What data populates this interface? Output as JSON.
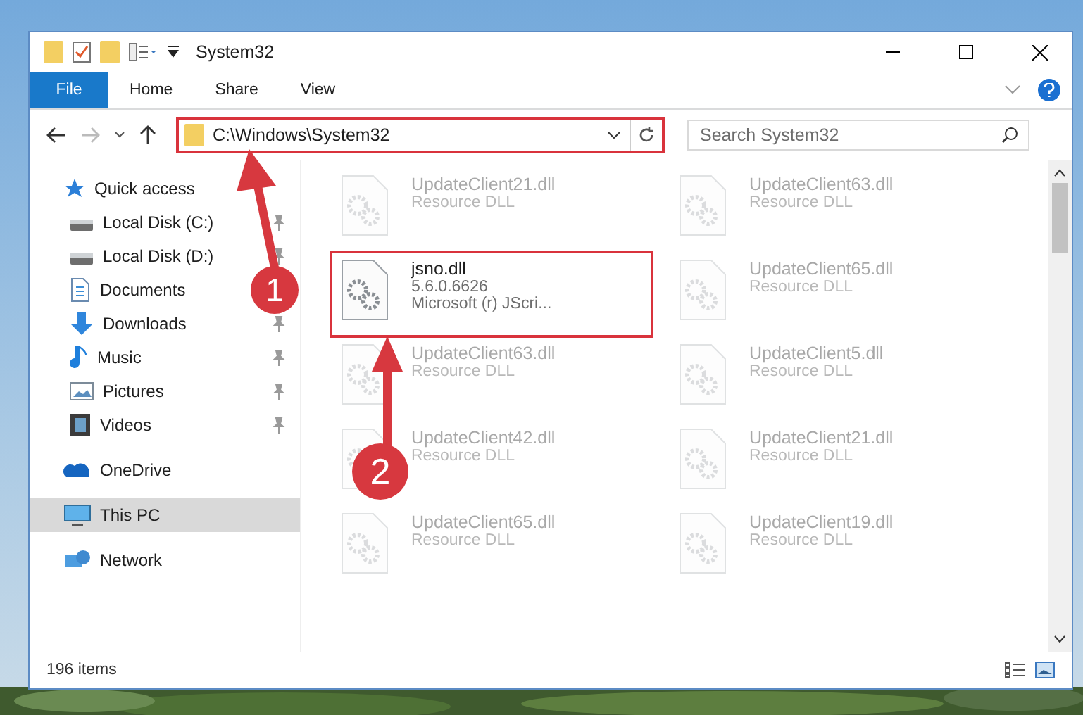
{
  "window": {
    "title": "System32"
  },
  "ribbon": {
    "tabs": [
      {
        "label": "File",
        "selected": true
      },
      {
        "label": "Home",
        "selected": false
      },
      {
        "label": "Share",
        "selected": false
      },
      {
        "label": "View",
        "selected": false
      }
    ]
  },
  "address_bar": {
    "path": "C:\\Windows\\System32",
    "highlighted": true
  },
  "search": {
    "placeholder": "Search System32"
  },
  "sidebar": {
    "items": [
      {
        "label": "Quick access",
        "selected": false,
        "children": [
          {
            "label": "Local Disk (C:)",
            "pinned": true,
            "selected": false
          },
          {
            "label": "Local Disk (D:)",
            "pinned": true,
            "selected": false
          },
          {
            "label": "Documents",
            "selected": false
          },
          {
            "label": "Downloads",
            "pinned": true,
            "selected": false
          },
          {
            "label": "Music",
            "pinned": true,
            "selected": false
          },
          {
            "label": "Pictures",
            "pinned": true,
            "selected": false
          },
          {
            "label": "Videos",
            "pinned": true,
            "selected": false
          }
        ]
      },
      {
        "label": "OneDrive",
        "selected": false
      },
      {
        "label": "This PC",
        "selected": true
      },
      {
        "label": "Network",
        "selected": false
      }
    ]
  },
  "files": [
    {
      "name": "UpdateClient21.dll",
      "lines": [
        "Resource DLL"
      ],
      "faded": true,
      "highlighted": false
    },
    {
      "name": "UpdateClient63.dll",
      "lines": [
        "Resource DLL"
      ],
      "faded": true,
      "highlighted": false
    },
    {
      "name": "jsno.dll",
      "lines": [
        "5.6.0.6626",
        "Microsoft (r) JScri..."
      ],
      "faded": false,
      "highlighted": true
    },
    {
      "name": "UpdateClient65.dll",
      "lines": [
        "Resource DLL"
      ],
      "faded": true,
      "highlighted": false
    },
    {
      "name": "UpdateClient63.dll",
      "lines": [
        "Resource DLL"
      ],
      "faded": true,
      "highlighted": false
    },
    {
      "name": "UpdateClient5.dll",
      "lines": [
        "Resource DLL"
      ],
      "faded": true,
      "highlighted": false
    },
    {
      "name": "UpdateClient42.dll",
      "lines": [
        "Resource DLL"
      ],
      "faded": true,
      "highlighted": false
    },
    {
      "name": "UpdateClient21.dll",
      "lines": [
        "Resource DLL"
      ],
      "faded": true,
      "highlighted": false
    },
    {
      "name": "UpdateClient65.dll",
      "lines": [
        "Resource DLL"
      ],
      "faded": true,
      "highlighted": false
    },
    {
      "name": "UpdateClient19.dll",
      "lines": [
        "Resource DLL"
      ],
      "faded": true,
      "highlighted": false
    }
  ],
  "status_bar": {
    "count": "196 items"
  },
  "annotations": [
    {
      "number": "1"
    },
    {
      "number": "2"
    }
  ]
}
